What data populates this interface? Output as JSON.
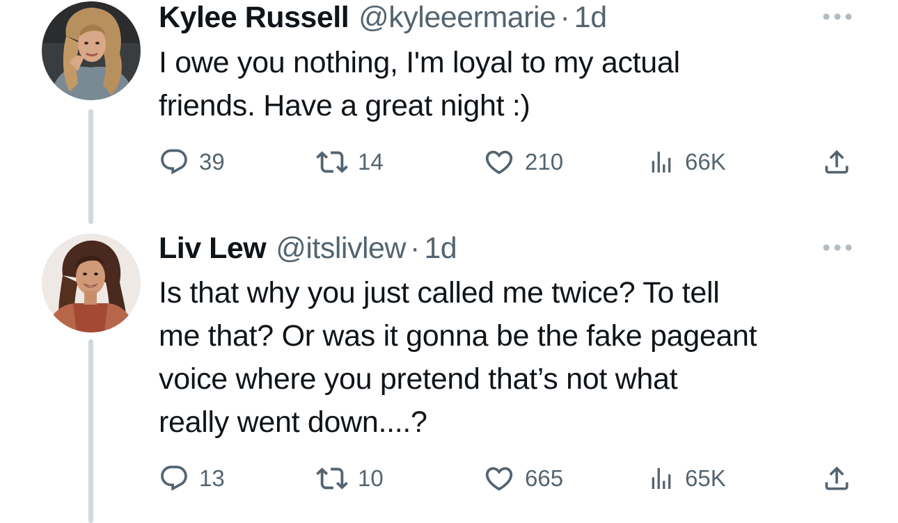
{
  "tweets": [
    {
      "author": {
        "name": "Kylee Russell",
        "handle": "@kyleeermarie",
        "time": "1d"
      },
      "text": "I owe you nothing, I'm loyal to my actual\nfriends. Have a great night :)",
      "stats": {
        "replies": "39",
        "retweets": "14",
        "likes": "210",
        "views": "66K"
      }
    },
    {
      "author": {
        "name": "Liv Lew",
        "handle": "@itslivlew",
        "time": "1d"
      },
      "text": "Is that why you just called me twice? To tell\nme that? Or was it gonna be the fake pageant\nvoice where you pretend that’s not what\nreally went down....?",
      "stats": {
        "replies": "13",
        "retweets": "10",
        "likes": "665",
        "views": "65K"
      }
    }
  ],
  "separator": "·",
  "colors": {
    "text_primary": "#0f1419",
    "text_secondary": "#536471",
    "thread_line": "#cfd9de",
    "background": "#ffffff"
  },
  "icons": {
    "reply": "reply-icon",
    "retweet": "retweet-icon",
    "like": "heart-icon",
    "views": "views-icon",
    "share": "share-icon",
    "more": "more-icon"
  }
}
